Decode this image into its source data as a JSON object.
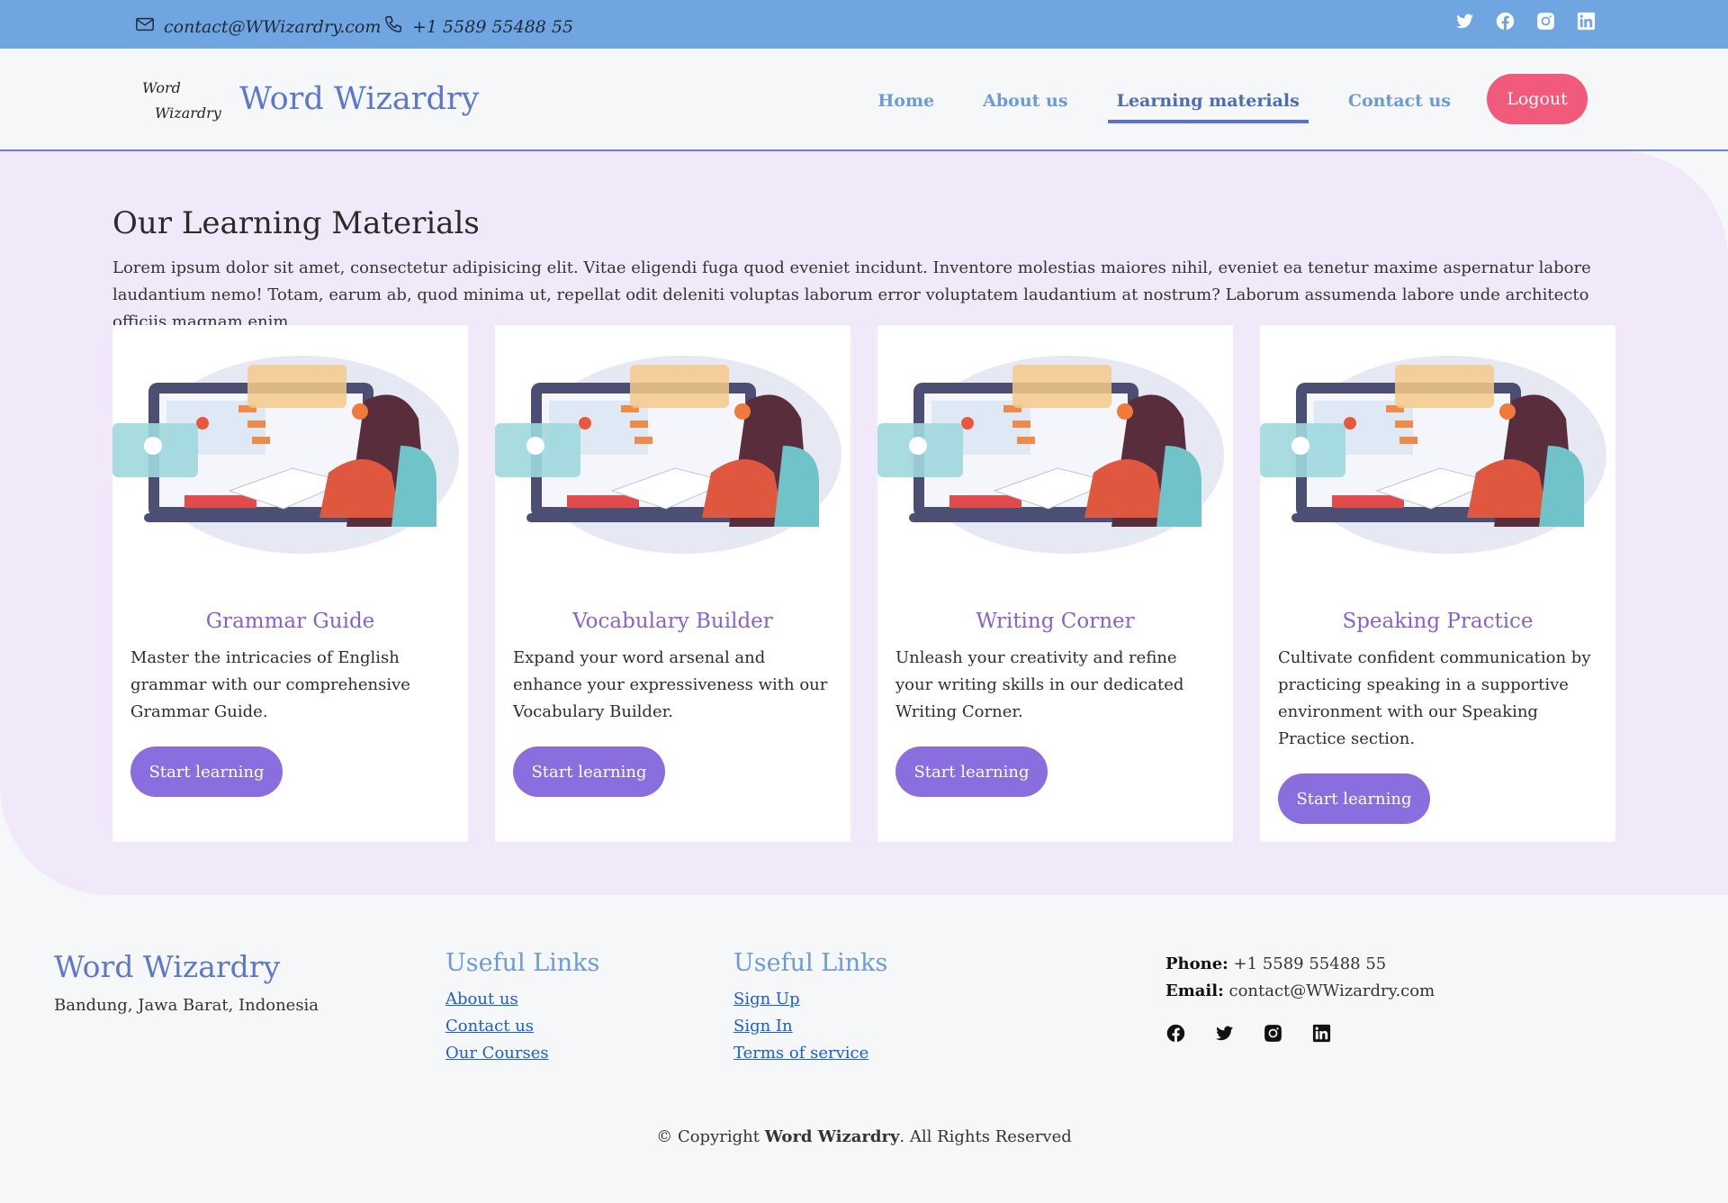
{
  "topbar": {
    "email": "contact@WWizardry.com",
    "phone": "+1 5589 55488 55",
    "socials": [
      "twitter-icon",
      "facebook-icon",
      "instagram-icon",
      "linkedin-icon"
    ]
  },
  "header": {
    "logo_line1": "Word",
    "logo_line2": "Wizardry",
    "brand": "Word Wizardry",
    "nav": [
      "Home",
      "About us",
      "Learning materials",
      "Contact us"
    ],
    "active_nav": "Learning materials",
    "logout": "Logout"
  },
  "hero": {
    "title": "Our Learning Materials",
    "intro": "Lorem ipsum dolor sit amet, consectetur adipisicing elit. Vitae eligendi fuga quod eveniet incidunt. Inventore molestias maiores nihil, eveniet ea tenetur maxime aspernatur labore laudantium nemo! Totam, earum ab, quod minima ut, repellat odit deleniti voluptas laborum error voluptatem laudantium at nostrum? Laborum assumenda labore unde architecto officiis magnam enim."
  },
  "cards": [
    {
      "title": "Grammar Guide",
      "text": "Master the intricacies of English grammar with our comprehensive Grammar Guide.",
      "button": "Start learning"
    },
    {
      "title": "Vocabulary Builder",
      "text": "Expand your word arsenal and enhance your expressiveness with our Vocabulary Builder.",
      "button": "Start learning"
    },
    {
      "title": "Writing Corner",
      "text": "Unleash your creativity and refine your writing skills in our dedicated Writing Corner.",
      "button": "Start learning"
    },
    {
      "title": "Speaking Practice",
      "text": "Cultivate confident communication by practicing speaking in a supportive environment with our Speaking Practice section.",
      "button": "Start learning"
    }
  ],
  "footer": {
    "brand": "Word Wizardry",
    "address": "Bandung, Jawa Barat, Indonesia",
    "links1_title": "Useful Links",
    "links1": [
      "About us",
      "Contact us",
      "Our Courses"
    ],
    "links2_title": "Useful Links",
    "links2": [
      "Sign Up",
      "Sign In",
      "Terms of service"
    ],
    "phone_label": "Phone:",
    "phone": "+1 5589 55488 55",
    "email_label": "Email:",
    "email": "contact@WWizardry.com",
    "socials": [
      "facebook-icon",
      "twitter-icon",
      "instagram-icon",
      "linkedin-icon"
    ],
    "copyright_prefix": "© Copyright",
    "copyright_brand": "Word Wizardry",
    "copyright_suffix": ". All Rights Reserved"
  },
  "colors": {
    "topbar": "#6fa5e0",
    "brand": "#5c78cd",
    "logout": "#f25a7c",
    "hero_bg": "#f1e9f9",
    "card_title": "#8562d1",
    "card_button": "#8a6ee0"
  }
}
